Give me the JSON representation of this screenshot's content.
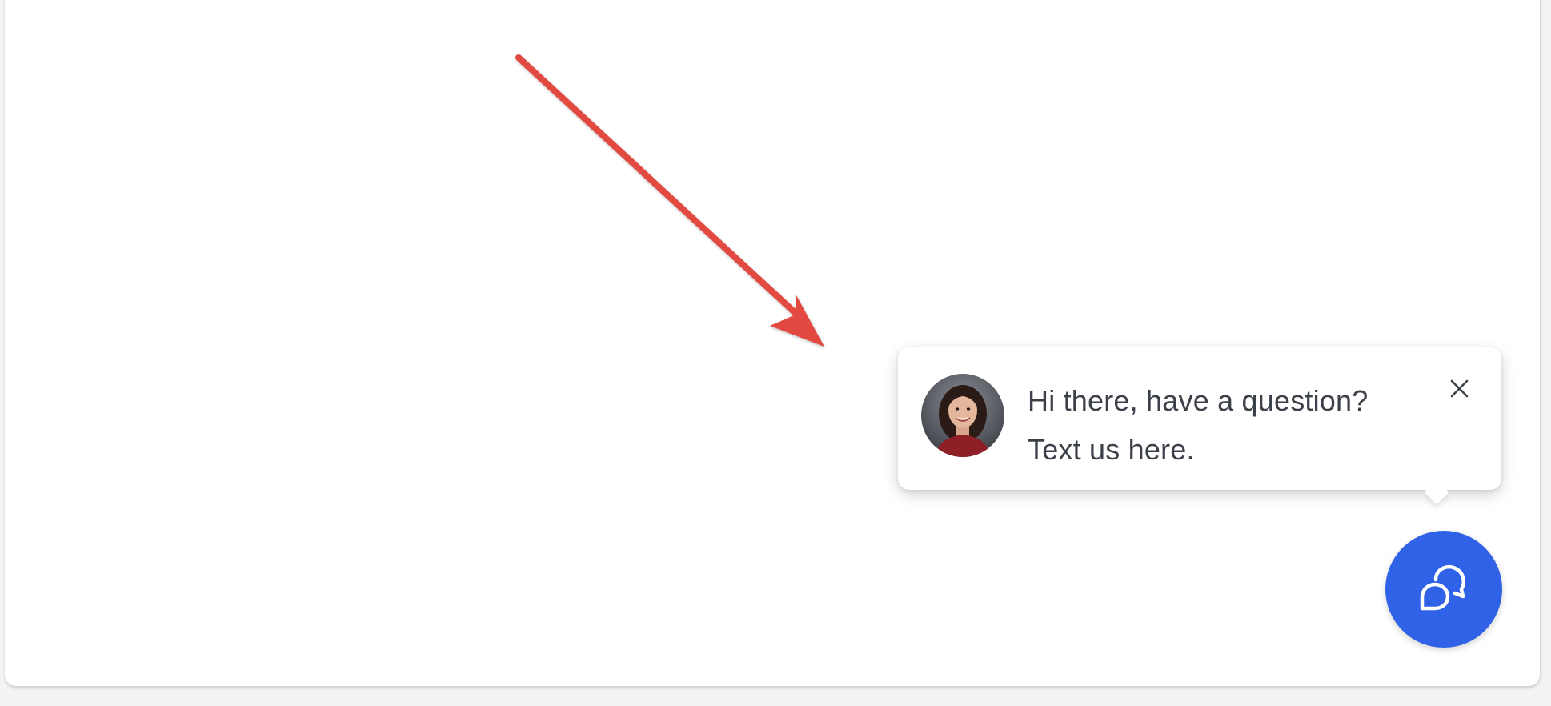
{
  "chat_widget": {
    "popup": {
      "message_line1": "Hi there, have a question?",
      "message_line2": "Text us here.",
      "avatar_icon": "agent-avatar",
      "close_icon": "close-icon"
    },
    "launcher": {
      "icon": "chat-bubbles-icon",
      "color": "#2f62e6"
    }
  },
  "annotation": {
    "type": "arrow",
    "color": "#e2493f"
  }
}
